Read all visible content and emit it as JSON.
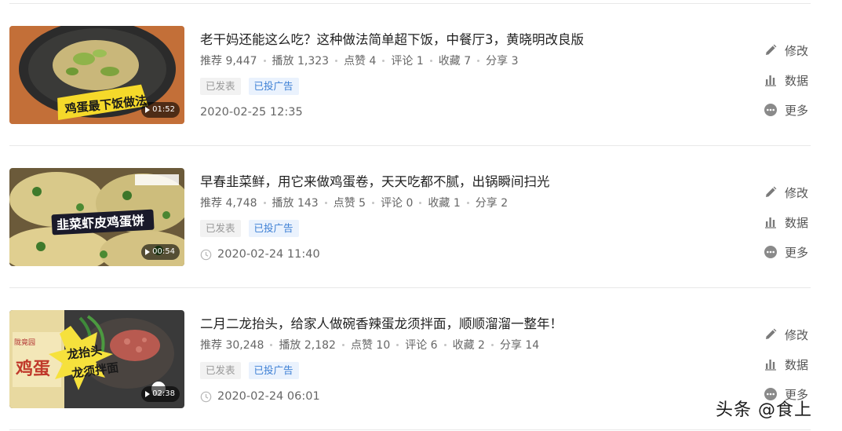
{
  "articles": [
    {
      "title": "老干妈还能这么吃？这种做法简单超下饭，中餐厅3，黄晓明改良版",
      "stats": {
        "recommend": "推荐 9,447",
        "play": "播放 1,323",
        "like": "点赞 4",
        "comment": "评论 1",
        "collect": "收藏 7",
        "share": "分享 3"
      },
      "tags": [
        "已发表",
        "已投广告"
      ],
      "time": "2020-02-25 12:35",
      "duration": "01:52",
      "thumb_caption": "鸡蛋最下饭做法"
    },
    {
      "title": "早春韭菜鲜，用它来做鸡蛋卷，天天吃都不腻，出锅瞬间扫光",
      "stats": {
        "recommend": "推荐 4,748",
        "play": "播放 143",
        "like": "点赞 5",
        "comment": "评论 0",
        "collect": "收藏 1",
        "share": "分享 2"
      },
      "tags": [
        "已发表",
        "已投广告"
      ],
      "time": "2020-02-24 11:40",
      "duration": "00:54",
      "thumb_caption": "韭菜虾皮鸡蛋饼"
    },
    {
      "title": "二月二龙抬头，给家人做碗香辣蛋龙须拌面，顺顺溜溜一整年！",
      "stats": {
        "recommend": "推荐 30,248",
        "play": "播放 2,182",
        "like": "点赞 10",
        "comment": "评论 6",
        "collect": "收藏 2",
        "share": "分享 14"
      },
      "tags": [
        "已发表",
        "已投广告"
      ],
      "time": "2020-02-24 06:01",
      "duration": "02:38",
      "thumb_caption_1": "龙抬头",
      "thumb_caption_2": "龙须拌面",
      "thumb_pack_text": "鸡蛋"
    }
  ],
  "actions": {
    "edit": "修改",
    "data": "数据",
    "more": "更多"
  },
  "watermark": "头条 @食上",
  "colors": {
    "tag_blue_bg": "#eaf2fd",
    "tag_blue_text": "#3c7fd4",
    "tag_gray_bg": "#f2f2f2",
    "tag_gray_text": "#999999"
  }
}
